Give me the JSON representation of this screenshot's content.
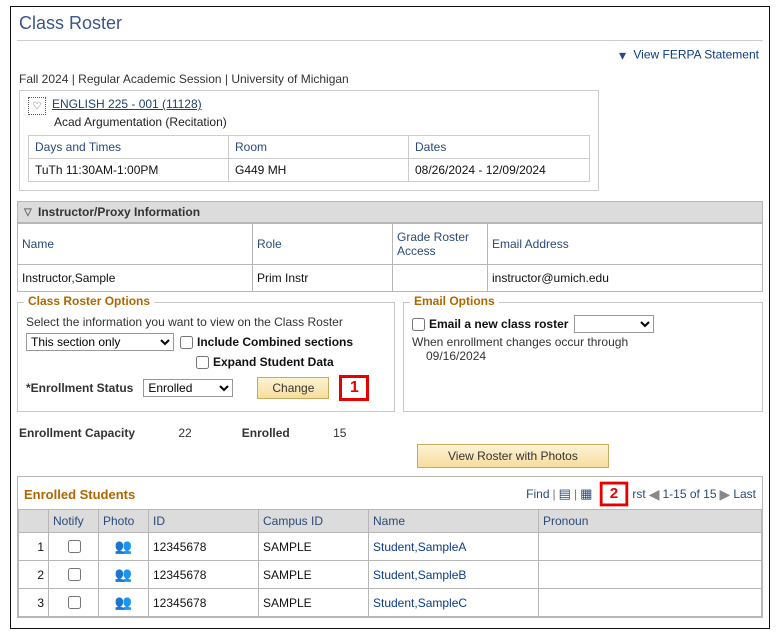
{
  "page_title": "Class Roster",
  "ferpa_link": "View FERPA Statement",
  "session_line": "Fall 2024 | Regular Academic Session | University of Michigan",
  "course": {
    "link": "ENGLISH 225 - 001 (11128)",
    "sub": "Acad Argumentation (Recitation)",
    "headers": {
      "days": "Days and Times",
      "room": "Room",
      "dates": "Dates"
    },
    "days": "TuTh 11:30AM-1:00PM",
    "room": "G449 MH",
    "dates": "08/26/2024 - 12/09/2024"
  },
  "instructor": {
    "section_title": "Instructor/Proxy Information",
    "headers": {
      "name": "Name",
      "role": "Role",
      "gra": "Grade Roster Access",
      "email": "Email Address"
    },
    "name": "Instructor,Sample",
    "role": "Prim Instr",
    "access": "",
    "email": "instructor@umich.edu"
  },
  "options": {
    "title": "Class Roster Options",
    "desc": "Select the information you want to view on the Class Roster",
    "section_select": "This section only",
    "include_combined": "Include Combined sections",
    "expand_data": "Expand Student Data",
    "enroll_status_label": "*Enrollment Status",
    "enroll_status_value": "Enrolled",
    "change_btn": "Change"
  },
  "email": {
    "title": "Email Options",
    "chk_label": "Email a new class roster",
    "note1": "When enrollment changes occur through",
    "note2": "09/16/2024"
  },
  "callouts": {
    "one": "1",
    "two": "2"
  },
  "capacity": {
    "cap_label": "Enrollment Capacity",
    "cap_value": "22",
    "enrolled_label": "Enrolled",
    "enrolled_value": "15"
  },
  "roster_photo_btn": "View Roster with Photos",
  "roster": {
    "title": "Enrolled Students",
    "find": "Find",
    "rst_fragment": "rst",
    "range": "1-15 of 15",
    "last": "Last",
    "headers": {
      "notify": "Notify",
      "photo": "Photo",
      "id": "ID",
      "campus": "Campus ID",
      "name": "Name",
      "pronoun": "Pronoun"
    },
    "rows": [
      {
        "n": "1",
        "id": "12345678",
        "campus": "SAMPLE",
        "name": "Student,SampleA"
      },
      {
        "n": "2",
        "id": "12345678",
        "campus": "SAMPLE",
        "name": "Student,SampleB"
      },
      {
        "n": "3",
        "id": "12345678",
        "campus": "SAMPLE",
        "name": "Student,SampleC"
      }
    ]
  }
}
